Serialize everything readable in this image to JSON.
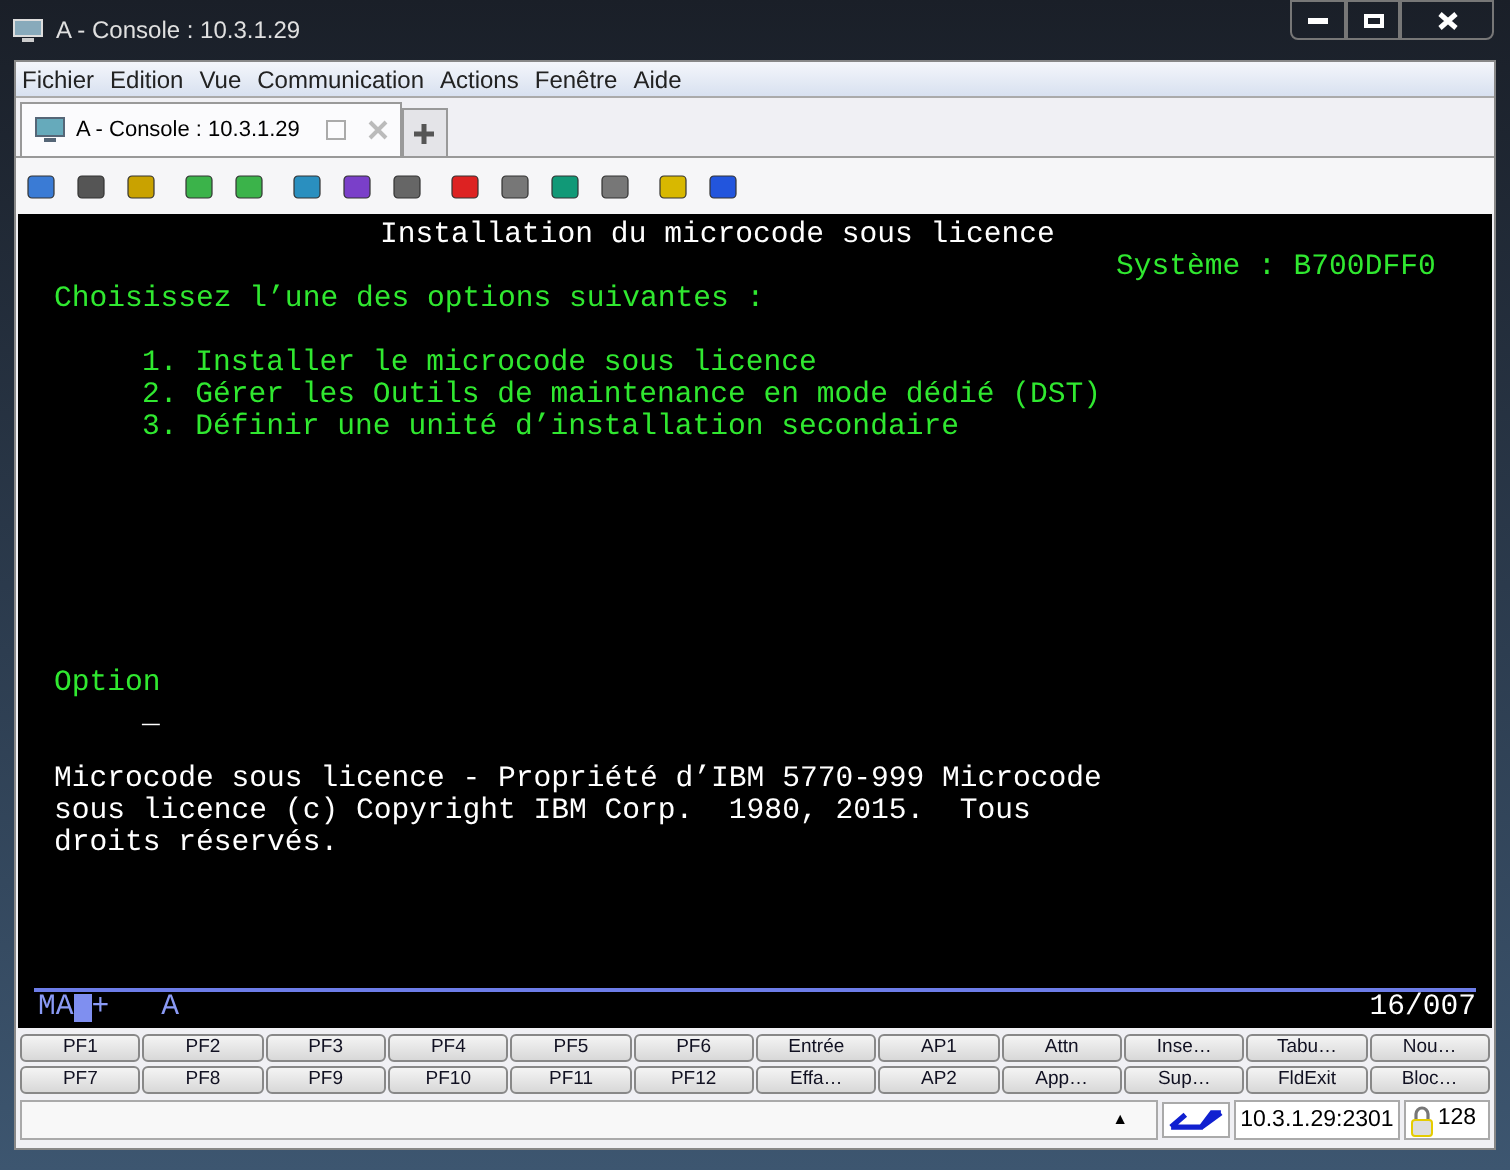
{
  "window": {
    "title": "A - Console : 10.3.1.29"
  },
  "menu": [
    "Fichier",
    "Edition",
    "Vue",
    "Communication",
    "Actions",
    "Fenêtre",
    "Aide"
  ],
  "tabs": [
    {
      "label": "A - Console : 10.3.1.29",
      "selected": true
    }
  ],
  "terminal": {
    "lines": [
      {
        "kind": "title",
        "text": "Installation du microcode sous licence"
      },
      {
        "kind": "system",
        "text": "Système : B700DFF0"
      },
      {
        "kind": "prompt",
        "text": "Choisissez l’une des options suivantes :"
      },
      {
        "kind": "option",
        "text": "1. Installer le microcode sous licence"
      },
      {
        "kind": "option",
        "text": "2. Gérer les Outils de maintenance en mode dédié (DST)"
      },
      {
        "kind": "option",
        "text": "3. Définir une unité d’installation secondaire"
      },
      {
        "kind": "field_label",
        "text": "Option"
      },
      {
        "kind": "input",
        "text": "_"
      },
      {
        "kind": "body",
        "text": "Microcode sous licence - Propriété d’IBM 5770-999 Microcode"
      },
      {
        "kind": "body",
        "text": "sous licence (c) Copyright IBM Corp.  1980, 2015.  Tous"
      },
      {
        "kind": "body",
        "text": "droits réservés."
      }
    ],
    "oia": {
      "mode": "MA",
      "plus": "+",
      "shift": "A",
      "position": "16/007"
    }
  },
  "function_keys": [
    [
      "PF1",
      "PF2",
      "PF3",
      "PF4",
      "PF5",
      "PF6",
      "Entrée",
      "AP1",
      "Attn",
      "Inse…",
      "Tabu…",
      "Nou…"
    ],
    [
      "PF7",
      "PF8",
      "PF9",
      "PF10",
      "PF11",
      "PF12",
      "Effa…",
      "AP2",
      "App…",
      "Sup…",
      "FldExit",
      "Bloc…"
    ]
  ],
  "status_bar": {
    "arrow": "▲",
    "address": "10.3.1.29:2301",
    "count": "128"
  }
}
